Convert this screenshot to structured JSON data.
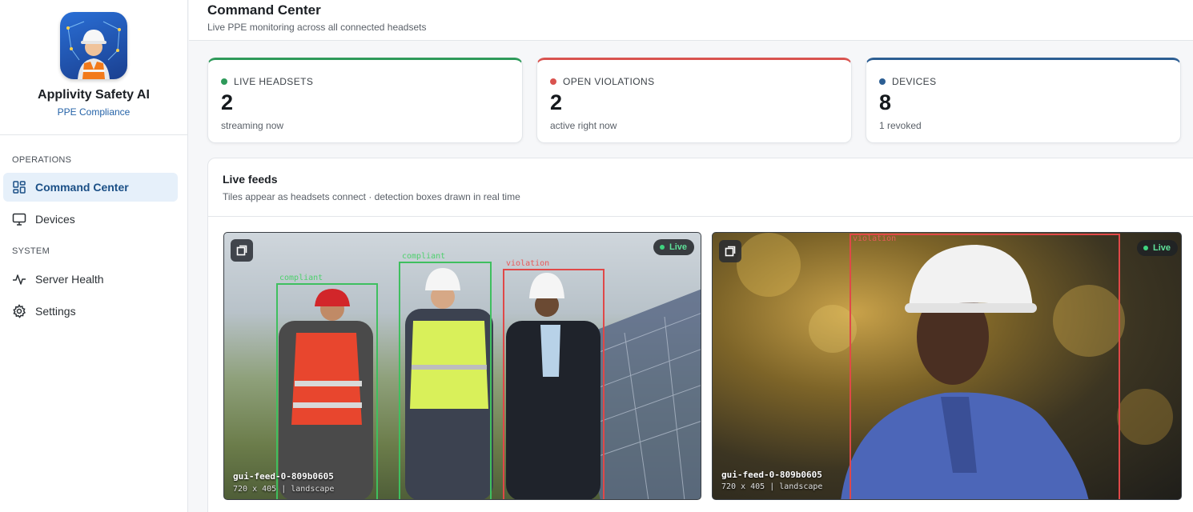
{
  "brand": {
    "name": "Applivity Safety AI",
    "subtitle": "PPE Compliance"
  },
  "nav": {
    "sections": [
      {
        "label": "OPERATIONS"
      },
      {
        "label": "SYSTEM"
      }
    ],
    "items": [
      {
        "label": "Command Center",
        "icon": "dashboard-grid-icon",
        "active": true
      },
      {
        "label": "Devices",
        "icon": "monitor-icon",
        "active": false
      },
      {
        "label": "Server Health",
        "icon": "activity-pulse-icon",
        "active": false
      },
      {
        "label": "Settings",
        "icon": "gear-icon",
        "active": false
      }
    ]
  },
  "header": {
    "title": "Command Center",
    "subtitle": "Live PPE monitoring across all connected headsets"
  },
  "stats": [
    {
      "label": "LIVE HEADSETS",
      "value": "2",
      "note": "streaming now",
      "color": "#2e9a5a"
    },
    {
      "label": "OPEN VIOLATIONS",
      "value": "2",
      "note": "active right now",
      "color": "#d9534f"
    },
    {
      "label": "DEVICES",
      "value": "8",
      "note": "1 revoked",
      "color": "#2c5e93"
    }
  ],
  "feeds_panel": {
    "title": "Live feeds",
    "subtitle": "Tiles appear as headsets connect · detection boxes drawn in real time"
  },
  "feeds": [
    {
      "id": "gui-feed-0-809b0605",
      "meta": "720 x 405 | landscape",
      "status": "Live",
      "detections": [
        {
          "label": "compliant",
          "kind": "compliant"
        },
        {
          "label": "compliant",
          "kind": "compliant"
        },
        {
          "label": "violation",
          "kind": "violation"
        }
      ]
    },
    {
      "id": "gui-feed-0-809b0605",
      "meta": "720 x 405 | landscape",
      "status": "Live",
      "detections": [
        {
          "label": "violation",
          "kind": "violation"
        }
      ]
    }
  ],
  "colors": {
    "accent": "#1a4f86",
    "active_bg": "#e6f0fa",
    "compliant": "#3fbf5f",
    "violation": "#e04848",
    "live": "#3fd47f"
  }
}
